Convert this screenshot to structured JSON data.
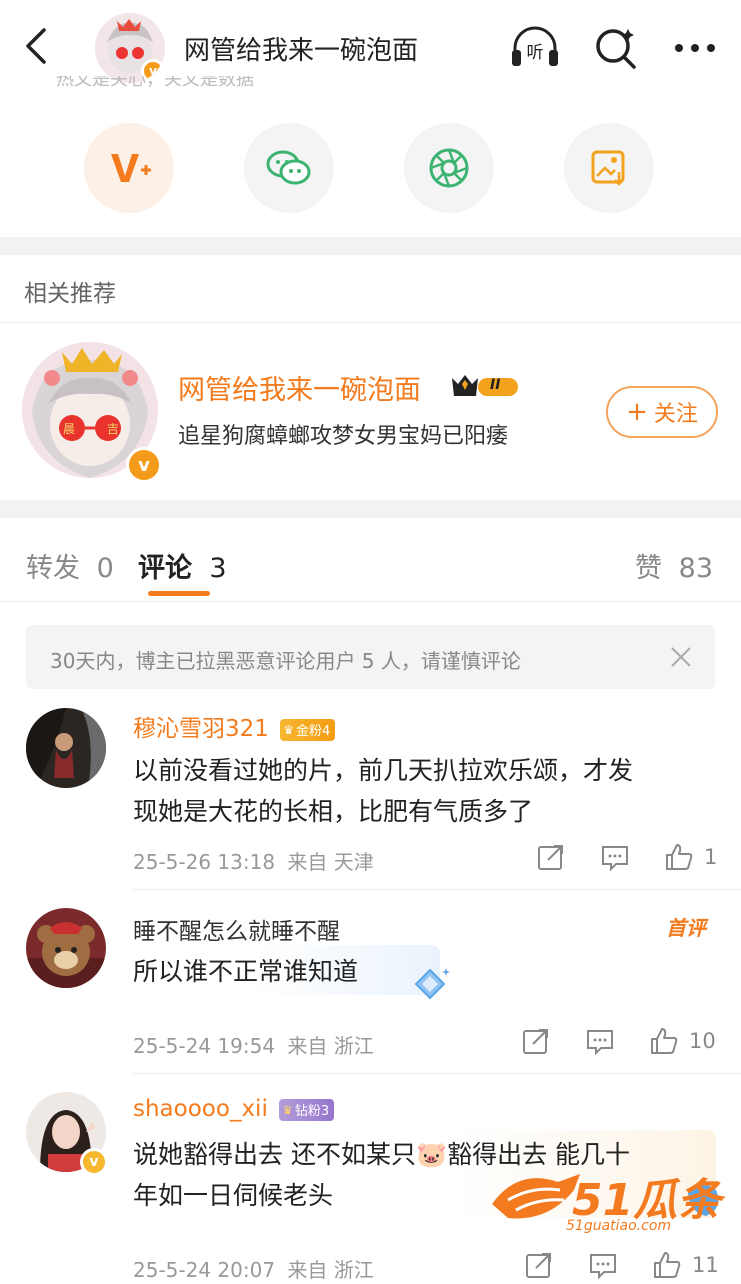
{
  "header": {
    "title": "网管给我来一碗泡面",
    "listen_label": "听",
    "partial_text": "热文是关心，关文是数据"
  },
  "share": {
    "items": [
      "v-plus",
      "wechat",
      "moments",
      "save-image"
    ]
  },
  "related": {
    "section_title": "相关推荐",
    "user_name": "网管给我来一碗泡面",
    "level_badge": "II",
    "description": "追星狗腐蟑螂攻梦女男宝妈已阳痿",
    "follow_label": "关注",
    "follow_plus": "+",
    "avatar_text": "晨 吉"
  },
  "tabs": {
    "repost_label": "转发",
    "repost_count": "0",
    "comment_label": "评论",
    "comment_count": "3",
    "like_label": "赞",
    "like_count": "83"
  },
  "notice": {
    "text": "30天内，博主已拉黑恶意评论用户 5 人，请谨慎评论"
  },
  "comments": [
    {
      "name": "穆沁雪羽321",
      "badge": "金粉4",
      "text_line1": "以前没看过她的片，前几天扒拉欢乐颂，才发",
      "text_line2": "现她是大花的长相，比肥有气质多了",
      "time": "25-5-26 13:18",
      "from": "来自 天津",
      "likes": "1"
    },
    {
      "name": "睡不醒怎么就睡不醒",
      "tag": "首评",
      "text_line1": "所以谁不正常谁知道",
      "time": "25-5-24 19:54",
      "from": "来自 浙江",
      "likes": "10"
    },
    {
      "name": "shaoooo_xii",
      "badge": "钻粉3",
      "text_line1": "说她豁得出去 还不如某只🐷豁得出去 能几十",
      "text_line2": "年如一日伺候老头",
      "time": "25-5-24 20:07",
      "from": "来自 浙江",
      "likes": "11"
    }
  ],
  "watermark": {
    "brand": "51瓜条",
    "url": "51guatiao.com"
  },
  "colors": {
    "accent": "#f37b1d",
    "vip": "#f49b1c"
  }
}
